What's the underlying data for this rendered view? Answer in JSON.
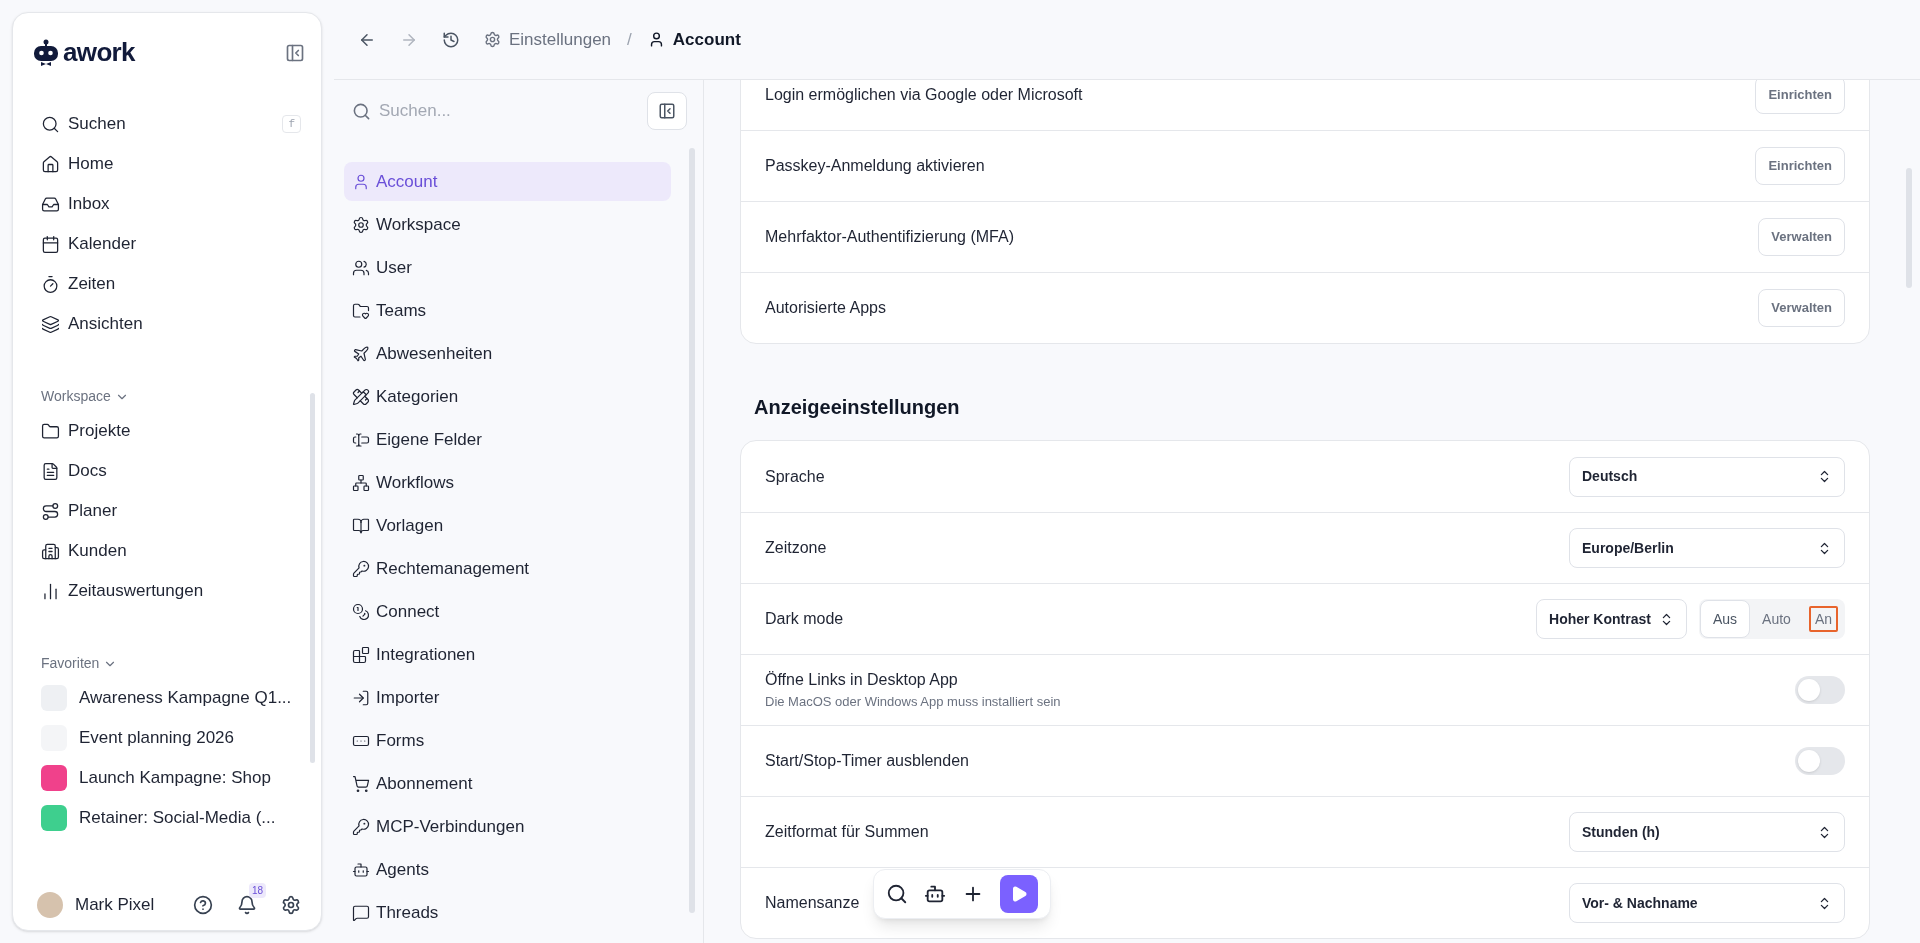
{
  "sidebar": {
    "logo": "awork",
    "search_shortcut": "f",
    "nav": [
      {
        "label": "Suchen",
        "selected": false
      },
      {
        "label": "Home",
        "selected": false
      },
      {
        "label": "Inbox",
        "selected": false
      },
      {
        "label": "Kalender",
        "selected": false
      },
      {
        "label": "Zeiten",
        "selected": false
      },
      {
        "label": "Ansichten",
        "selected": false
      }
    ],
    "workspace": {
      "title": "Workspace",
      "expanded": true,
      "items": [
        {
          "label": "Projekte",
          "selected": false
        },
        {
          "label": "Docs",
          "selected": false
        },
        {
          "label": "Planer",
          "selected": false
        },
        {
          "label": "Kunden",
          "selected": false
        },
        {
          "label": "Zeitauswertungen",
          "selected": false
        }
      ]
    },
    "favorites": {
      "title": "Favoriten",
      "expanded": true,
      "items": [
        {
          "label": "Awareness Kampagne Q1...",
          "color": "#eef0f3"
        },
        {
          "label": "Event planning 2026",
          "color": "#f4f5f7"
        },
        {
          "label": "Launch Kampagne: Shop",
          "color": "#f0418b"
        },
        {
          "label": "Retainer: Social-Media (...",
          "color": "#3ecf8e"
        }
      ]
    },
    "user": {
      "name": "Mark Pixel"
    },
    "notifications": {
      "count": "18"
    }
  },
  "breadcrumb": {
    "items": [
      "Einstellungen",
      "Account"
    ],
    "separator": "/"
  },
  "settings_nav": {
    "search": {
      "placeholder": "Suchen..."
    },
    "items": [
      {
        "label": "Account",
        "selected": true
      },
      {
        "label": "Workspace",
        "selected": false
      },
      {
        "label": "User",
        "selected": false
      },
      {
        "label": "Teams",
        "selected": false
      },
      {
        "label": "Abwesenheiten",
        "selected": false
      },
      {
        "label": "Kategorien",
        "selected": false
      },
      {
        "label": "Eigene Felder",
        "selected": false
      },
      {
        "label": "Workflows",
        "selected": false
      },
      {
        "label": "Vorlagen",
        "selected": false
      },
      {
        "label": "Rechtemanagement",
        "selected": false
      },
      {
        "label": "Connect",
        "selected": false
      },
      {
        "label": "Integrationen",
        "selected": false
      },
      {
        "label": "Importer",
        "selected": false
      },
      {
        "label": "Forms",
        "selected": false
      },
      {
        "label": "Abonnement",
        "selected": false
      },
      {
        "label": "MCP-Verbindungen",
        "selected": false
      },
      {
        "label": "Agents",
        "selected": false
      },
      {
        "label": "Threads",
        "selected": false
      }
    ]
  },
  "security_rows": [
    {
      "label": "Login ermöglichen via Google oder Microsoft",
      "button": "Einrichten"
    },
    {
      "label": "Passkey-Anmeldung aktivieren",
      "button": "Einrichten"
    },
    {
      "label": "Mehrfaktor-Authentifizierung (MFA)",
      "button": "Verwalten"
    },
    {
      "label": "Autorisierte Apps",
      "button": "Verwalten"
    }
  ],
  "display": {
    "title": "Anzeigeeinstellungen",
    "rows": [
      {
        "kind": "select",
        "label": "Sprache",
        "value": "Deutsch"
      },
      {
        "kind": "select",
        "label": "Zeitzone",
        "value": "Europe/Berlin"
      },
      {
        "kind": "mode",
        "label": "Dark mode",
        "value": "Hoher Kontrast",
        "options": [
          {
            "label": "Aus",
            "selected": true,
            "focused": false
          },
          {
            "label": "Auto",
            "selected": false,
            "focused": false
          },
          {
            "label": "An",
            "selected": false,
            "focused": true
          }
        ]
      },
      {
        "kind": "toggle",
        "label": "Öffne Links in Desktop App",
        "description": "Die MacOS oder Windows App muss installiert sein",
        "on": false
      },
      {
        "kind": "toggle",
        "label": "Start/Stop-Timer ausblenden",
        "on": false
      },
      {
        "kind": "select",
        "label": "Zeitformat für Summen",
        "value": "Stunden (h)"
      },
      {
        "kind": "select",
        "label": "Namensanze",
        "value": "Vor- & Nachname"
      }
    ]
  }
}
